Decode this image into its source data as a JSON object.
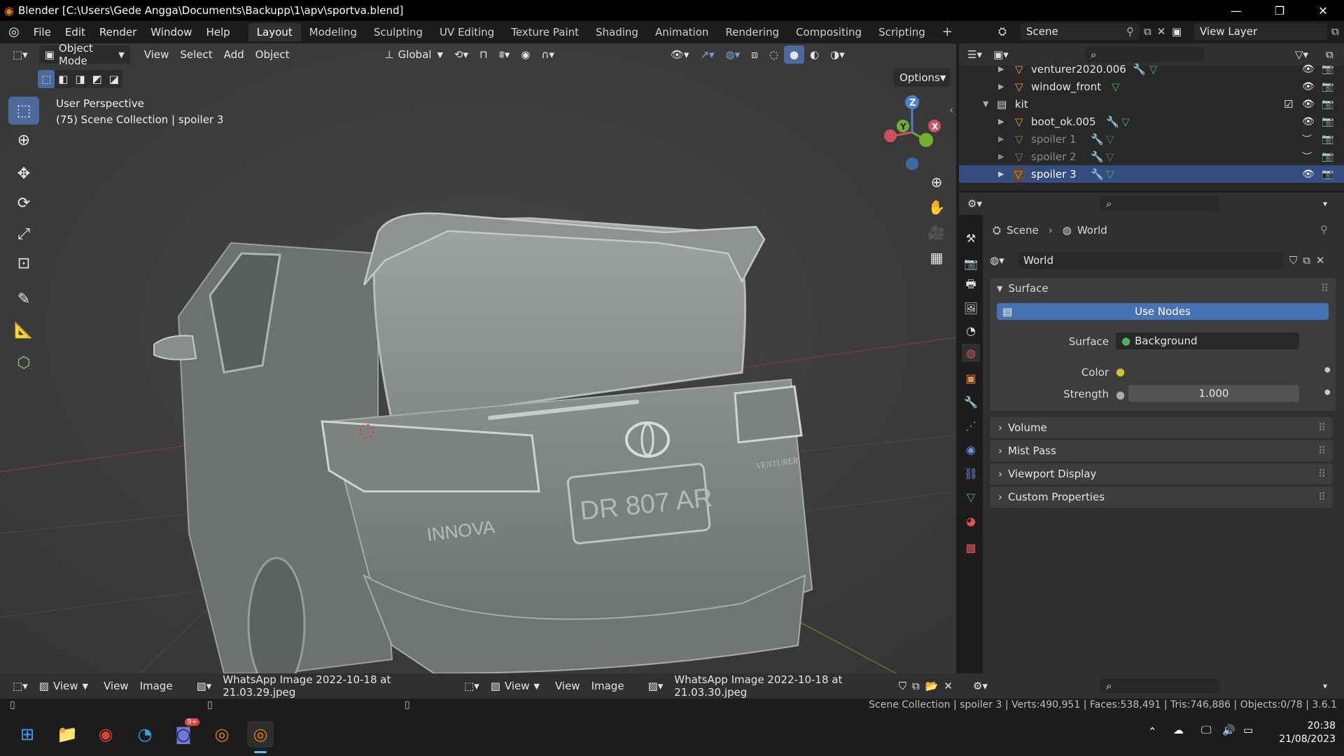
{
  "window": {
    "title": "Blender [C:\\Users\\Gede Angga\\Documents\\Backupp\\1\\apv\\sportva.blend]",
    "minimize": "—",
    "maximize": "❐",
    "close": "✕"
  },
  "menu": [
    "File",
    "Edit",
    "Render",
    "Window",
    "Help"
  ],
  "workspaces": [
    "Layout",
    "Modeling",
    "Sculpting",
    "UV Editing",
    "Texture Paint",
    "Shading",
    "Animation",
    "Rendering",
    "Compositing",
    "Scripting"
  ],
  "scene": {
    "name": "Scene",
    "view_layer": "View Layer"
  },
  "viewport": {
    "mode": "Object Mode",
    "menus": [
      "View",
      "Select",
      "Add",
      "Object"
    ],
    "transform_orientation": "Global",
    "options_label": "Options",
    "overlay_text": [
      "User Perspective",
      "(75) Scene Collection | spoiler 3"
    ],
    "gizmo": {
      "z": "Z",
      "y": "Y",
      "x": "X"
    },
    "plate_text": "DR 807 AR",
    "badge_text": "INNOVA",
    "venturer_text": "VENTURER"
  },
  "outliner": {
    "items": [
      {
        "label": "venturer2020.006",
        "indent": 1,
        "dim": false,
        "visible": true
      },
      {
        "label": "window_front",
        "indent": 1,
        "dim": false,
        "visible": true
      },
      {
        "label": "kit",
        "indent": 0,
        "dim": false,
        "visible": true
      },
      {
        "label": "boot_ok.005",
        "indent": 1,
        "dim": false,
        "visible": true
      },
      {
        "label": "spoiler 1",
        "indent": 1,
        "dim": true,
        "visible": false
      },
      {
        "label": "spoiler 2",
        "indent": 1,
        "dim": true,
        "visible": false
      },
      {
        "label": "spoiler 3",
        "indent": 1,
        "dim": false,
        "visible": true
      }
    ]
  },
  "properties": {
    "breadcrumb": [
      "Scene",
      "World"
    ],
    "world_name": "World",
    "surface_panel": "Surface",
    "use_nodes": "Use Nodes",
    "surface_label": "Surface",
    "surface_value": "Background",
    "color_label": "Color",
    "strength_label": "Strength",
    "strength_value": "1.000",
    "panels": [
      "Volume",
      "Mist Pass",
      "Viewport Display",
      "Custom Properties"
    ]
  },
  "image_editors": [
    {
      "view": "View",
      "menus": [
        "View",
        "Image"
      ],
      "image": "WhatsApp Image 2022-10-18 at 21.03.29.jpeg"
    },
    {
      "view": "View",
      "menus": [
        "View",
        "Image"
      ],
      "image": "WhatsApp Image 2022-10-18 at 21.03.30.jpeg"
    }
  ],
  "status": "Scene Collection | spoiler 3 | Verts:490,951 | Faces:538,491 | Tris:746,886 | Objects:0/78 | 3.6.1",
  "taskbar": {
    "time": "20:38",
    "date": "21/08/2023",
    "discord_badge": "9+"
  },
  "colors": {
    "accent": "#4b6b9f",
    "use_nodes_blue": "#4772b3",
    "mesh_orange": "#e5a050",
    "vertex_green": "#49b35f"
  }
}
